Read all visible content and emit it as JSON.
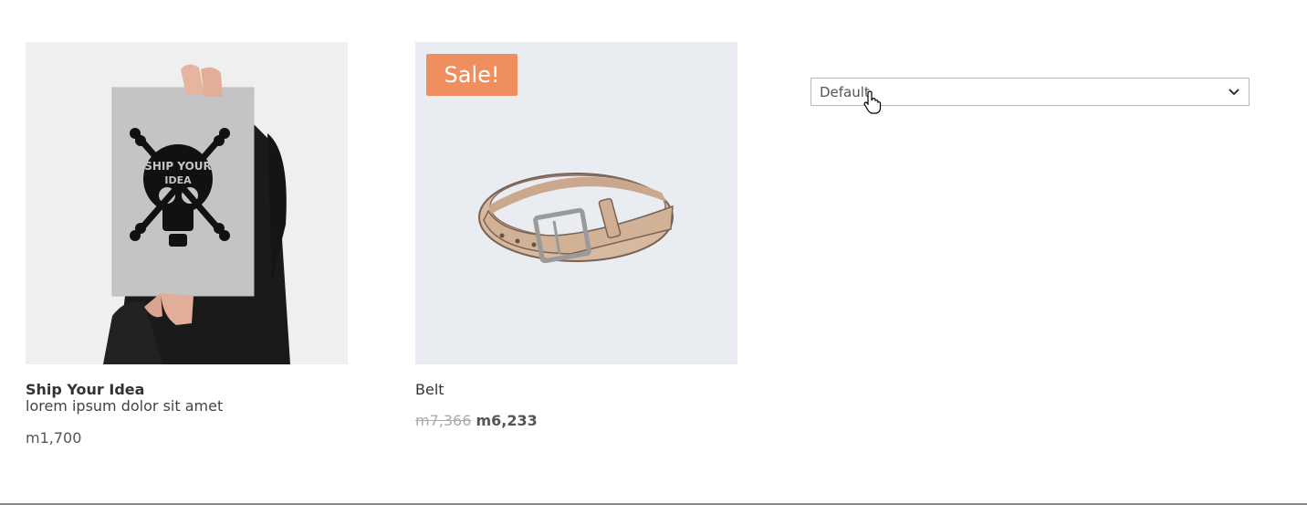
{
  "products": [
    {
      "title": "Ship Your Idea",
      "subtitle": "lorem ipsum dolor sit amet",
      "price": "m1,700",
      "image_icon": "poster-image"
    },
    {
      "title": "Belt",
      "sale_badge": "Sale!",
      "old_price": "m7,366",
      "new_price": "m6,233",
      "image_icon": "belt-image"
    }
  ],
  "sort": {
    "selected": "Default",
    "icon": "chevron-down-icon"
  },
  "colors": {
    "sale_badge": "#ef8f5f",
    "thumb_bg_1": "#efefef",
    "thumb_bg_2": "#e9edf2"
  }
}
